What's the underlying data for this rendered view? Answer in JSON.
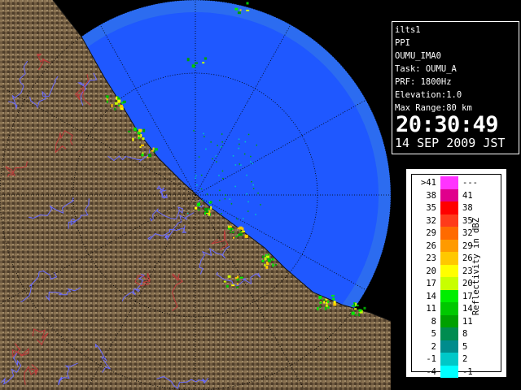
{
  "info": {
    "lines": [
      "ilts1",
      "PPI",
      "OUMU_IMA0",
      "Task: OUMU_A",
      "PRF: 1800Hz",
      "Elevation:1.0",
      "Max Range:80 km"
    ],
    "time": "20:30:49",
    "date": "14 SEP 2009 JST"
  },
  "legend": {
    "unit": "Reflectivity in dBZ",
    "rows": [
      {
        "low": ">41",
        "high": "---",
        "color": "#ff33ff"
      },
      {
        "low": "38",
        "high": "41",
        "color": "#e0008c"
      },
      {
        "low": "35",
        "high": "38",
        "color": "#ff0000"
      },
      {
        "low": "32",
        "high": "35",
        "color": "#ff3a1a"
      },
      {
        "low": "29",
        "high": "32",
        "color": "#ff6a00"
      },
      {
        "low": "26",
        "high": "29",
        "color": "#ff9a00"
      },
      {
        "low": "23",
        "high": "26",
        "color": "#ffc800"
      },
      {
        "low": "20",
        "high": "23",
        "color": "#ffff00"
      },
      {
        "low": "17",
        "high": "20",
        "color": "#c8ff00"
      },
      {
        "low": "14",
        "high": "17",
        "color": "#00ee00"
      },
      {
        "low": "11",
        "high": "14",
        "color": "#00c800"
      },
      {
        "low": "8",
        "high": "11",
        "color": "#00a000"
      },
      {
        "low": "5",
        "high": "8",
        "color": "#008c50"
      },
      {
        "low": "2",
        "high": "5",
        "color": "#008c8c"
      },
      {
        "low": "-1",
        "high": "2",
        "color": "#00c8c8"
      },
      {
        "low": "-4",
        "high": "-1",
        "color": "#00ffff"
      }
    ]
  },
  "colors": {
    "sea_outer": "#2c6cf0",
    "sea_inner": "#1f58ff",
    "land": "#6f5a40",
    "rivers": "#6a6cff",
    "borders": "#c03a3a"
  }
}
